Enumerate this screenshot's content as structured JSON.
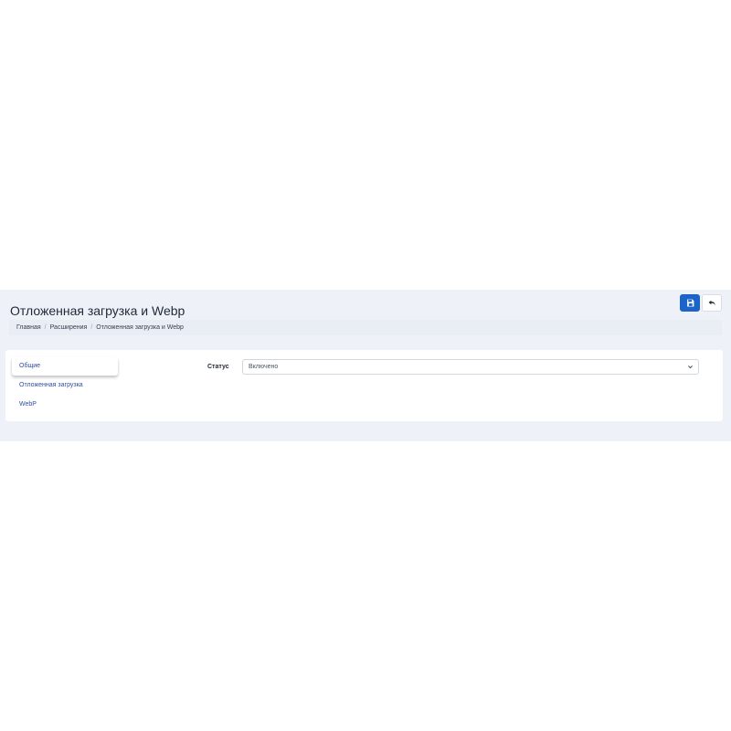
{
  "page": {
    "title": "Отложенная загрузка и Webp"
  },
  "header": {
    "save_icon": "save-icon",
    "back_icon": "undo-arrow-icon",
    "accent_color": "#1d64c8"
  },
  "breadcrumb": {
    "items": [
      "Главная",
      "Расширения",
      "Отложенная загрузка и Webp"
    ],
    "separator": "/"
  },
  "tabs": [
    {
      "label": "Общие",
      "active": true
    },
    {
      "label": "Отложенная загрузка",
      "active": false
    },
    {
      "label": "WebP",
      "active": false
    }
  ],
  "form": {
    "status_label": "Статус",
    "status_value": "Включено"
  }
}
